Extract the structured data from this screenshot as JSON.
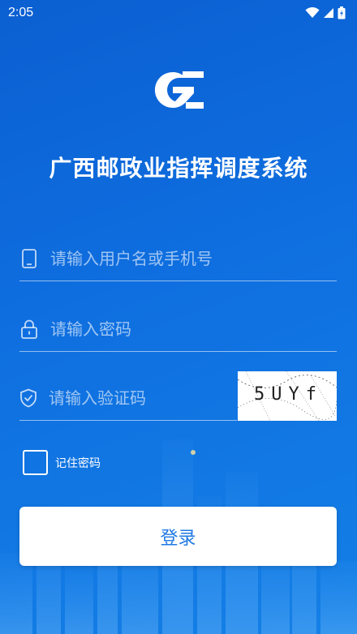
{
  "status_bar": {
    "time": "2:05",
    "icons": [
      "wifi-icon",
      "signal-icon",
      "battery-charging-icon"
    ]
  },
  "app": {
    "title": "广西邮政业指挥调度系统",
    "logo_icon": "brand-logo-icon"
  },
  "form": {
    "username": {
      "placeholder": "请输入用户名或手机号",
      "value": "",
      "icon": "phone-icon"
    },
    "password": {
      "placeholder": "请输入密码",
      "value": "",
      "icon": "lock-icon"
    },
    "captcha": {
      "placeholder": "请输入验证码",
      "value": "",
      "icon": "shield-check-icon",
      "image_text": "5UYf"
    },
    "remember_label": "记住密码",
    "remember_checked": false,
    "login_label": "登录"
  },
  "colors": {
    "background_start": "#0b5fd1",
    "background_end": "#1480e6",
    "button_text": "#1f79e2"
  }
}
